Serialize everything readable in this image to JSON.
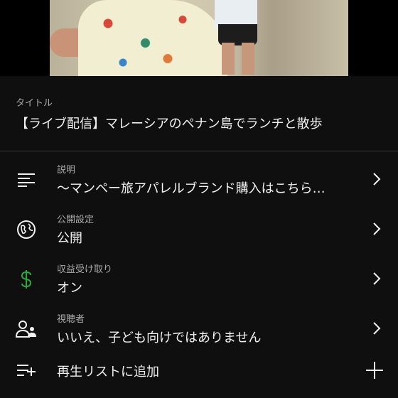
{
  "title_section": {
    "label": "タイトル",
    "value": "【ライブ配信】マレーシアのペナン島でランチと散歩"
  },
  "settings": [
    {
      "label": "説明",
      "value": "〜マンペー旅アパレルブランド購入はこちら…",
      "icon": "description-lines-icon"
    },
    {
      "label": "公開設定",
      "value": "公開",
      "icon": "globe-icon"
    },
    {
      "label": "収益受け取り",
      "value": "オン",
      "icon": "dollar-icon"
    },
    {
      "label": "視聴者",
      "value": "いいえ、子ども向けではありません",
      "icon": "audience-person-icon"
    }
  ],
  "playlist": {
    "label": "再生リストに追加",
    "icon": "add-to-playlist-icon",
    "action_icon": "plus-icon"
  },
  "colors": {
    "background": "#0f0f0f",
    "text": "#f1f1f1",
    "muted": "#aaaaaa",
    "monetization": "#2ba640"
  }
}
